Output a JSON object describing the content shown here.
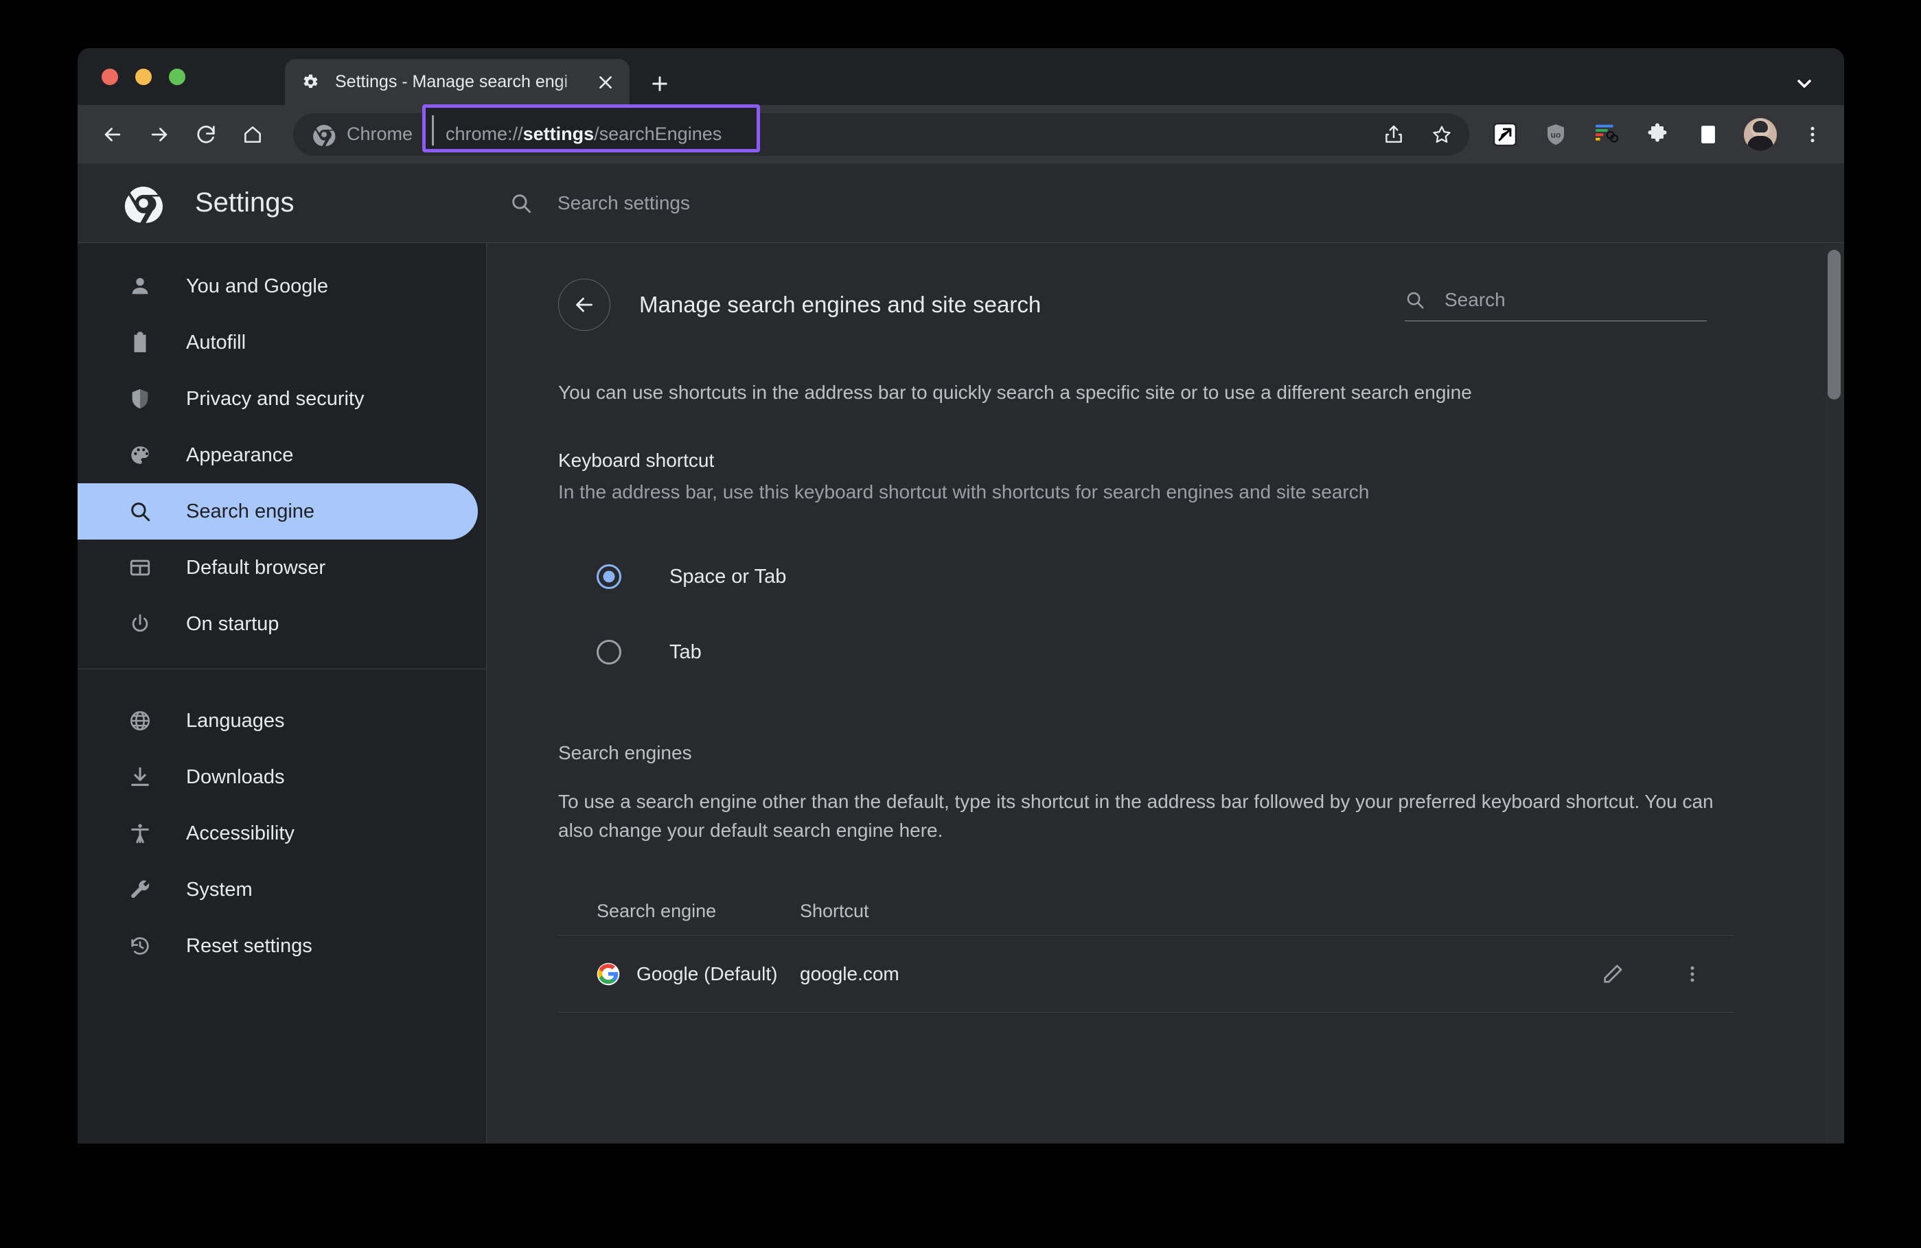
{
  "window": {
    "traffic_lights": [
      "close",
      "minimize",
      "maximize"
    ],
    "chevron_icon": "chevron-down-icon"
  },
  "tab": {
    "favicon": "gear-icon",
    "title": "Settings - Manage search engi",
    "close_icon": "close-icon",
    "new_tab_icon": "plus-icon"
  },
  "toolbar": {
    "back_icon": "arrow-left-icon",
    "forward_icon": "arrow-right-icon",
    "reload_icon": "reload-icon",
    "home_icon": "home-icon",
    "chrome_pill_label": "Chrome",
    "chrome_pill_icon": "chrome-logo-icon",
    "url_prefix": "chrome://",
    "url_bold": "settings",
    "url_suffix": "/searchEngines",
    "url_highlight_color": "#8b5cf6",
    "share_icon": "share-icon",
    "bookmark_icon": "star-icon",
    "extensions": [
      "cursor-arrow-extension-icon",
      "ublock-origin-icon",
      "link-bars-extension-icon",
      "puzzle-piece-icon",
      "side-panel-icon"
    ],
    "avatar": "avatar",
    "menu_icon": "three-dot-menu-icon"
  },
  "settings_header": {
    "brand_icon": "chrome-logo-icon",
    "brand_title": "Settings",
    "search_icon": "search-icon",
    "search_placeholder": "Search settings",
    "search_value": ""
  },
  "sidebar": {
    "groups": [
      {
        "items": [
          {
            "label": "You and Google",
            "icon": "person-icon",
            "active": false
          },
          {
            "label": "Autofill",
            "icon": "clipboard-icon",
            "active": false
          },
          {
            "label": "Privacy and security",
            "icon": "shield-icon",
            "active": false
          },
          {
            "label": "Appearance",
            "icon": "palette-icon",
            "active": false
          },
          {
            "label": "Search engine",
            "icon": "search-icon",
            "active": true
          },
          {
            "label": "Default browser",
            "icon": "browser-window-icon",
            "active": false
          },
          {
            "label": "On startup",
            "icon": "power-icon",
            "active": false
          }
        ]
      },
      {
        "items": [
          {
            "label": "Languages",
            "icon": "globe-icon",
            "active": false
          },
          {
            "label": "Downloads",
            "icon": "download-icon",
            "active": false
          },
          {
            "label": "Accessibility",
            "icon": "accessibility-icon",
            "active": false
          },
          {
            "label": "System",
            "icon": "wrench-icon",
            "active": false
          },
          {
            "label": "Reset settings",
            "icon": "history-restore-icon",
            "active": false
          }
        ]
      }
    ],
    "active_bg_color": "#a8c7fa"
  },
  "main": {
    "back_icon": "arrow-left-icon",
    "page_title": "Manage search engines and site search",
    "search_icon": "search-icon",
    "search_placeholder": "Search",
    "search_value": "",
    "intro": "You can use shortcuts in the address bar to quickly search a specific site or to use a different search engine",
    "keyboard_shortcut": {
      "title": "Keyboard shortcut",
      "description": "In the address bar, use this keyboard shortcut with shortcuts for search engines and site search",
      "options": [
        {
          "label": "Space or Tab",
          "selected": true
        },
        {
          "label": "Tab",
          "selected": false
        }
      ]
    },
    "search_engines": {
      "title": "Search engines",
      "description": "To use a search engine other than the default, type its shortcut in the address bar followed by your preferred keyboard shortcut. You can also change your default search engine here.",
      "columns": [
        "Search engine",
        "Shortcut"
      ],
      "rows": [
        {
          "name": "Google (Default)",
          "shortcut": "google.com",
          "favicon": "google-g-icon",
          "edit_icon": "pencil-icon",
          "menu_icon": "three-dot-menu-icon"
        }
      ]
    }
  }
}
